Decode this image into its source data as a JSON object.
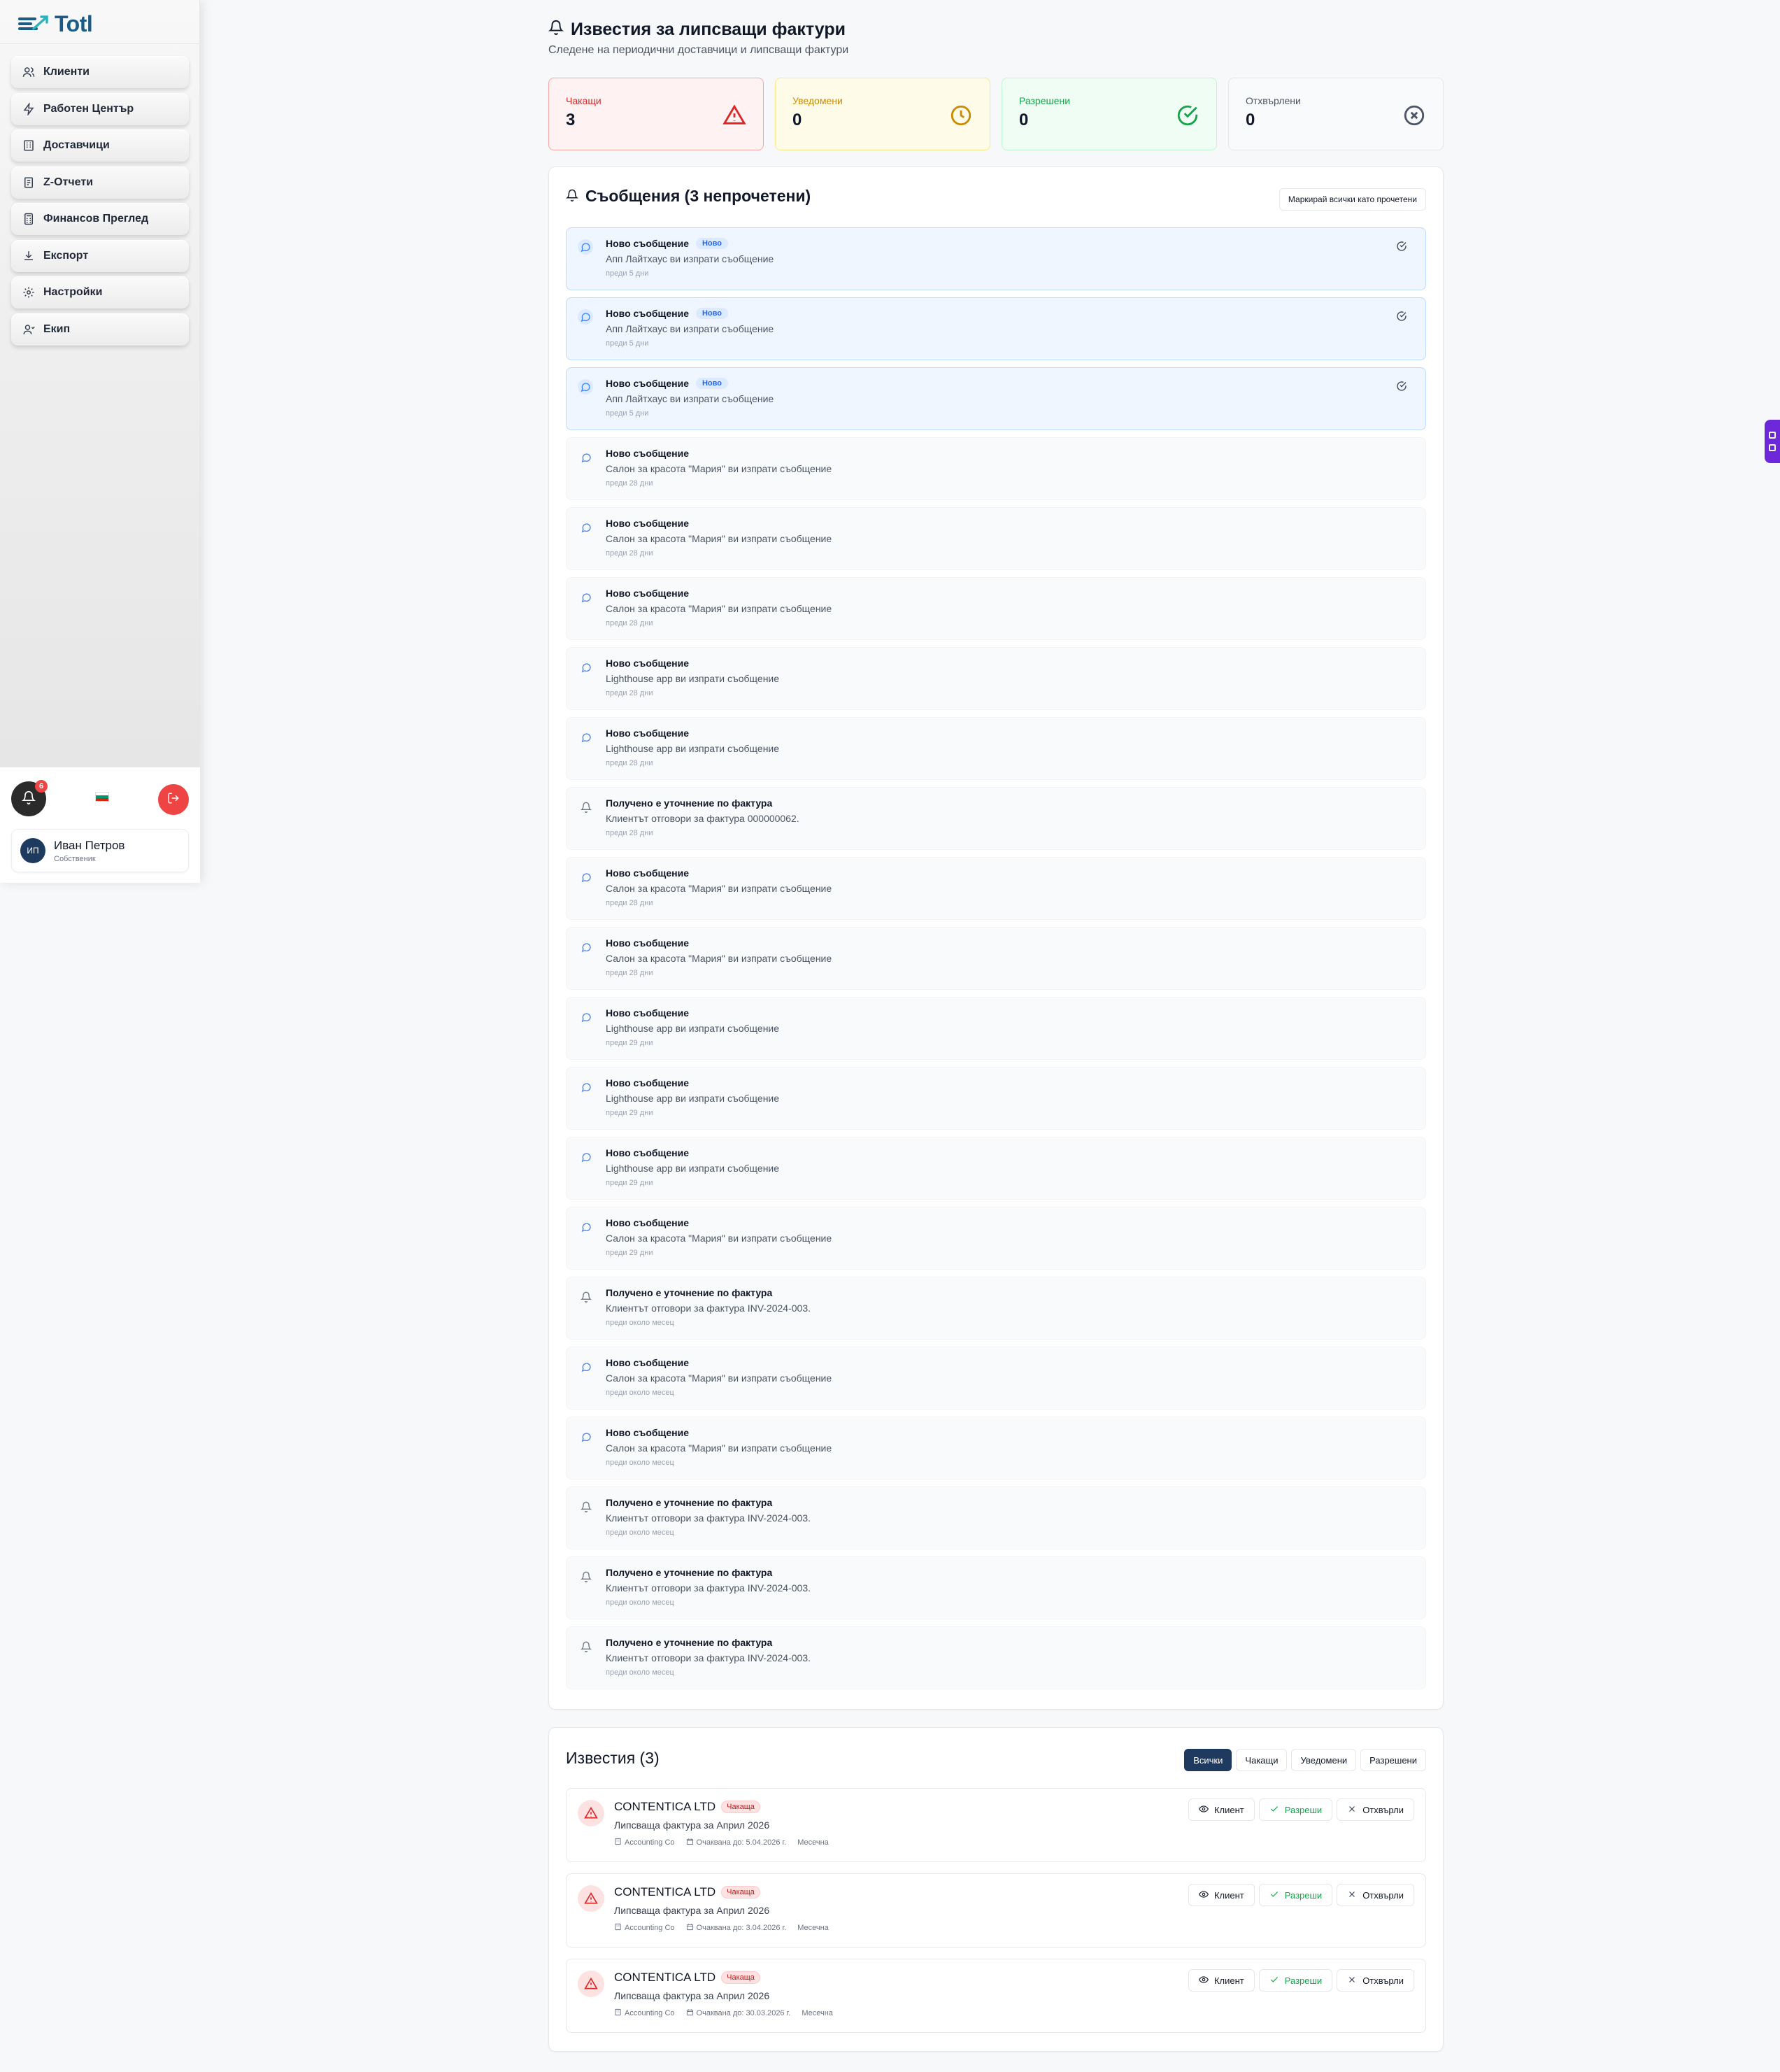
{
  "app": {
    "name": "Totl"
  },
  "sidebar": {
    "items": [
      {
        "label": "Клиенти",
        "icon": "users-icon"
      },
      {
        "label": "Работен Център",
        "icon": "zap-icon"
      },
      {
        "label": "Доставчици",
        "icon": "building-icon"
      },
      {
        "label": "Z-Отчети",
        "icon": "receipt-icon"
      },
      {
        "label": "Финансов Преглед",
        "icon": "calculator-icon"
      },
      {
        "label": "Експорт",
        "icon": "download-icon"
      },
      {
        "label": "Настройки",
        "icon": "gear-icon"
      },
      {
        "label": "Екип",
        "icon": "team-icon"
      }
    ],
    "notification_count": "6",
    "user": {
      "initials": "ИП",
      "name": "Иван Петров",
      "role": "Собственик"
    }
  },
  "header": {
    "title": "Известия за липсващи фактури",
    "subtitle": "Следене на периодични доставчици и липсващи фактури"
  },
  "stats": [
    {
      "label": "Чакащи",
      "value": "3"
    },
    {
      "label": "Уведомени",
      "value": "0"
    },
    {
      "label": "Разрешени",
      "value": "0"
    },
    {
      "label": "Отхвърлени",
      "value": "0"
    }
  ],
  "messages_card": {
    "title": "Съобщения (3 непрочетени)",
    "mark_all_label": "Маркирай всички като прочетени",
    "new_badge": "Ново",
    "items": [
      {
        "type": "chat",
        "unread": true,
        "title": "Ново съобщение",
        "text": "Апп Лайтхаус ви изпрати съобщение",
        "time": "преди 5 дни"
      },
      {
        "type": "chat",
        "unread": true,
        "title": "Ново съобщение",
        "text": "Апп Лайтхаус ви изпрати съобщение",
        "time": "преди 5 дни"
      },
      {
        "type": "chat",
        "unread": true,
        "title": "Ново съобщение",
        "text": "Апп Лайтхаус ви изпрати съобщение",
        "time": "преди 5 дни"
      },
      {
        "type": "chat",
        "unread": false,
        "title": "Ново съобщение",
        "text": "Салон за красота \"Мария\" ви изпрати съобщение",
        "time": "преди 28 дни"
      },
      {
        "type": "chat",
        "unread": false,
        "title": "Ново съобщение",
        "text": "Салон за красота \"Мария\" ви изпрати съобщение",
        "time": "преди 28 дни"
      },
      {
        "type": "chat",
        "unread": false,
        "title": "Ново съобщение",
        "text": "Салон за красота \"Мария\" ви изпрати съобщение",
        "time": "преди 28 дни"
      },
      {
        "type": "chat",
        "unread": false,
        "title": "Ново съобщение",
        "text": "Lighthouse app ви изпрати съобщение",
        "time": "преди 28 дни"
      },
      {
        "type": "chat",
        "unread": false,
        "title": "Ново съобщение",
        "text": "Lighthouse app ви изпрати съобщение",
        "time": "преди 28 дни"
      },
      {
        "type": "bell",
        "unread": false,
        "title": "Получено е уточнение по фактура",
        "text": "Клиентът отговори за фактура 000000062.",
        "time": "преди 28 дни"
      },
      {
        "type": "chat",
        "unread": false,
        "title": "Ново съобщение",
        "text": "Салон за красота \"Мария\" ви изпрати съобщение",
        "time": "преди 28 дни"
      },
      {
        "type": "chat",
        "unread": false,
        "title": "Ново съобщение",
        "text": "Салон за красота \"Мария\" ви изпрати съобщение",
        "time": "преди 28 дни"
      },
      {
        "type": "chat",
        "unread": false,
        "title": "Ново съобщение",
        "text": "Lighthouse app ви изпрати съобщение",
        "time": "преди 29 дни"
      },
      {
        "type": "chat",
        "unread": false,
        "title": "Ново съобщение",
        "text": "Lighthouse app ви изпрати съобщение",
        "time": "преди 29 дни"
      },
      {
        "type": "chat",
        "unread": false,
        "title": "Ново съобщение",
        "text": "Lighthouse app ви изпрати съобщение",
        "time": "преди 29 дни"
      },
      {
        "type": "chat",
        "unread": false,
        "title": "Ново съобщение",
        "text": "Салон за красота \"Мария\" ви изпрати съобщение",
        "time": "преди 29 дни"
      },
      {
        "type": "bell",
        "unread": false,
        "title": "Получено е уточнение по фактура",
        "text": "Клиентът отговори за фактура INV-2024-003.",
        "time": "преди около месец"
      },
      {
        "type": "chat",
        "unread": false,
        "title": "Ново съобщение",
        "text": "Салон за красота \"Мария\" ви изпрати съобщение",
        "time": "преди около месец"
      },
      {
        "type": "chat",
        "unread": false,
        "title": "Ново съобщение",
        "text": "Салон за красота \"Мария\" ви изпрати съобщение",
        "time": "преди около месец"
      },
      {
        "type": "bell",
        "unread": false,
        "title": "Получено е уточнение по фактура",
        "text": "Клиентът отговори за фактура INV-2024-003.",
        "time": "преди около месец"
      },
      {
        "type": "bell",
        "unread": false,
        "title": "Получено е уточнение по фактура",
        "text": "Клиентът отговори за фактура INV-2024-003.",
        "time": "преди около месец"
      },
      {
        "type": "bell",
        "unread": false,
        "title": "Получено е уточнение по фактура",
        "text": "Клиентът отговори за фактура INV-2024-003.",
        "time": "преди около месец"
      }
    ]
  },
  "alerts_card": {
    "title": "Известия (3)",
    "filters": [
      "Всички",
      "Чакащи",
      "Уведомени",
      "Разрешени"
    ],
    "active_filter": "Всички",
    "actions": {
      "view": "Клиент",
      "resolve": "Разреши",
      "reject": "Отхвърли"
    },
    "items": [
      {
        "company": "CONTENTICA LTD",
        "status": "Чакаща",
        "desc": "Липсваща фактура за Април 2026",
        "firm": "Accounting Co",
        "expected": "Очаквана до: 5.04.2026 г.",
        "freq": "Месечна"
      },
      {
        "company": "CONTENTICA LTD",
        "status": "Чакаща",
        "desc": "Липсваща фактура за Април 2026",
        "firm": "Accounting Co",
        "expected": "Очаквана до: 3.04.2026 г.",
        "freq": "Месечна"
      },
      {
        "company": "CONTENTICA LTD",
        "status": "Чакаща",
        "desc": "Липсваща фактура за Април 2026",
        "firm": "Accounting Co",
        "expected": "Очаквана до: 30.03.2026 г.",
        "freq": "Месечна"
      }
    ]
  },
  "colors": {
    "brand": "#1d5b86",
    "primary_dark": "#1e3a5f",
    "danger": "#ef4444",
    "success": "#16a34a",
    "warning": "#ca8a04",
    "unread_bg": "#eff6ff",
    "widget": "#6d28d9"
  }
}
